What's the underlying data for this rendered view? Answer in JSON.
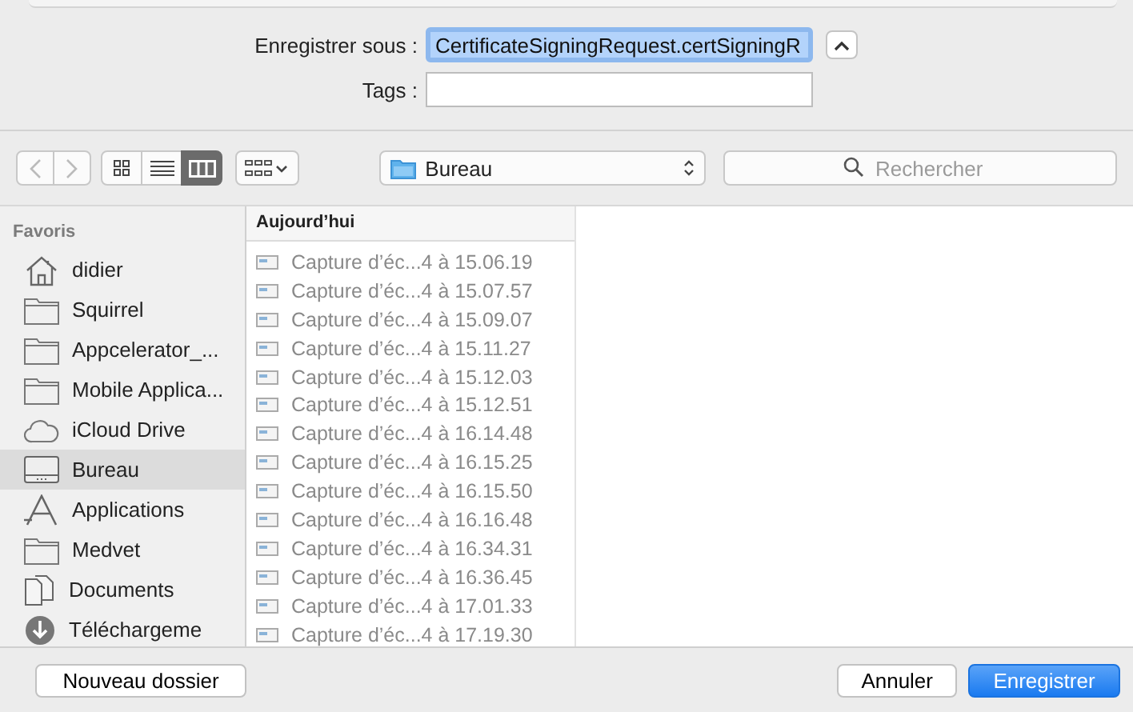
{
  "save_as": {
    "label": "Enregistrer sous :",
    "value": "CertificateSigningRequest.certSigningR"
  },
  "tags": {
    "label": "Tags :"
  },
  "view_modes": [
    {
      "kind": "icons",
      "selected": false
    },
    {
      "kind": "list",
      "selected": false
    },
    {
      "kind": "columns",
      "selected": true
    }
  ],
  "location": {
    "value": "Bureau"
  },
  "search": {
    "placeholder": "Rechercher"
  },
  "sidebar": {
    "heading": "Favoris",
    "items": [
      {
        "kind": "home",
        "label": "didier",
        "selected": false
      },
      {
        "kind": "folder",
        "label": "Squirrel",
        "selected": false
      },
      {
        "kind": "folder",
        "label": "Appcelerator_...",
        "selected": false
      },
      {
        "kind": "folder",
        "label": "Mobile Applica...",
        "selected": false
      },
      {
        "kind": "cloud",
        "label": "iCloud Drive",
        "selected": false
      },
      {
        "kind": "desktop",
        "label": "Bureau",
        "selected": true
      },
      {
        "kind": "apps",
        "label": "Applications",
        "selected": false
      },
      {
        "kind": "folder",
        "label": "Medvet",
        "selected": false
      },
      {
        "kind": "docs",
        "label": "Documents",
        "selected": false
      },
      {
        "kind": "download",
        "label": "Téléchargeme",
        "selected": false
      }
    ]
  },
  "column": {
    "heading": "Aujourd’hui",
    "files": [
      "Capture d’éc...4 à 15.06.19",
      "Capture d’éc...4 à 15.07.57",
      "Capture d’éc...4 à 15.09.07",
      "Capture d’éc...4 à 15.11.27",
      "Capture d’éc...4 à 15.12.03",
      "Capture d’éc...4 à 15.12.51",
      "Capture d’éc...4 à 16.14.48",
      "Capture d’éc...4 à 16.15.25",
      "Capture d’éc...4 à 16.15.50",
      "Capture d’éc...4 à 16.16.48",
      "Capture d’éc...4 à 16.34.31",
      "Capture d’éc...4 à 16.36.45",
      "Capture d’éc...4 à 17.01.33",
      "Capture d’éc...4 à 17.19.30"
    ]
  },
  "buttons": {
    "new_folder": "Nouveau dossier",
    "cancel": "Annuler",
    "save": "Enregistrer"
  }
}
